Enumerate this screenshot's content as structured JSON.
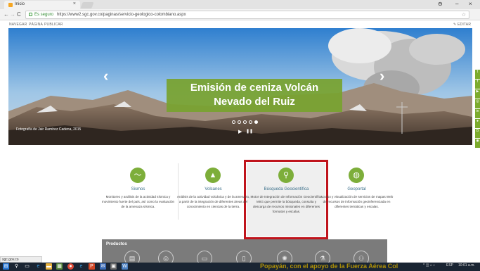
{
  "browser": {
    "tab_title": "Inicio",
    "tab_close": "×",
    "window_minimize": "–",
    "window_close": "×",
    "account_icon": "person-icon",
    "back_icon": "←",
    "forward_icon": "→",
    "reload_icon": "C",
    "security_label": "Es seguro",
    "url": "https://www2.sgc.gov.co/paginas/servicio-geologico-colombiano.aspx",
    "bookmark_star": "☆"
  },
  "site": {
    "nav_items": [
      "NAVEGAR",
      "PÁGINA",
      "PUBLICAR"
    ],
    "edit_label": "✎ EDITAR"
  },
  "hero": {
    "title_line1": "Emisión de ceniza Volcán",
    "title_line2": "Nevado del Ruiz",
    "caption": "Fotografía de Jair Ramírez Cadena, 2015",
    "prev_arrow": "‹",
    "next_arrow": "›",
    "play": "▶",
    "pause": "❚❚",
    "slide_count": 5,
    "active_slide": 5
  },
  "social": {
    "icons": [
      "twitter-icon",
      "facebook-icon",
      "youtube-icon",
      "instagram-icon",
      "linkedin-icon",
      "flickr-icon",
      "blog-icon",
      "rss-icon"
    ],
    "glyphs": [
      "t",
      "f",
      "▶",
      "◎",
      "in",
      "●",
      "B",
      "◉"
    ]
  },
  "services": [
    {
      "icon": "seismograph-icon",
      "glyph": "〜",
      "name": "Sismos",
      "desc": "Monitoreo y análisis de la actividad sísmica y movimiento fuerte del país, así como la evaluación de la amenaza sísmica."
    },
    {
      "icon": "volcano-icon",
      "glyph": "▲",
      "name": "Volcanes",
      "desc": "Análisis de la actividad volcánica y de la amenaza, a partir de la integración de diferentes áreas del conocimiento en ciencias de la tierra."
    },
    {
      "icon": "search-icon",
      "glyph": "⚲",
      "name": "Búsqueda Geocientífica",
      "desc": "Motor de Integración de Información Geocientífica MIIG que permite la búsqueda, consulta y descarga de recursos misionales en diferentes formatos y escalas."
    },
    {
      "icon": "globe-icon",
      "glyph": "◍",
      "name": "Geoportal",
      "desc": "Acceso y visualización de servicios de mapas Web de recursos de información geoinferenciada en diferentes temáticas y escalas."
    }
  ],
  "products": {
    "title": "Productos",
    "icons": [
      "document-icon",
      "map-icon",
      "report-icon",
      "tablet-icon",
      "atom-icon",
      "flask-icon",
      "group-icon"
    ],
    "glyphs": [
      "▤",
      "◎",
      "▭",
      "▯",
      "✺",
      "⚗",
      "⚇"
    ]
  },
  "status_bar": "sgc.gov.co",
  "taskbar": {
    "ticker": "Popayán, con el apoyo de la Fuerza Aérea Col",
    "clock": "10:01 a.m.",
    "tray": "ESP"
  },
  "colors": {
    "green": "#7dae3a",
    "highlight": "#c0141c",
    "banner": "#79a32f"
  }
}
